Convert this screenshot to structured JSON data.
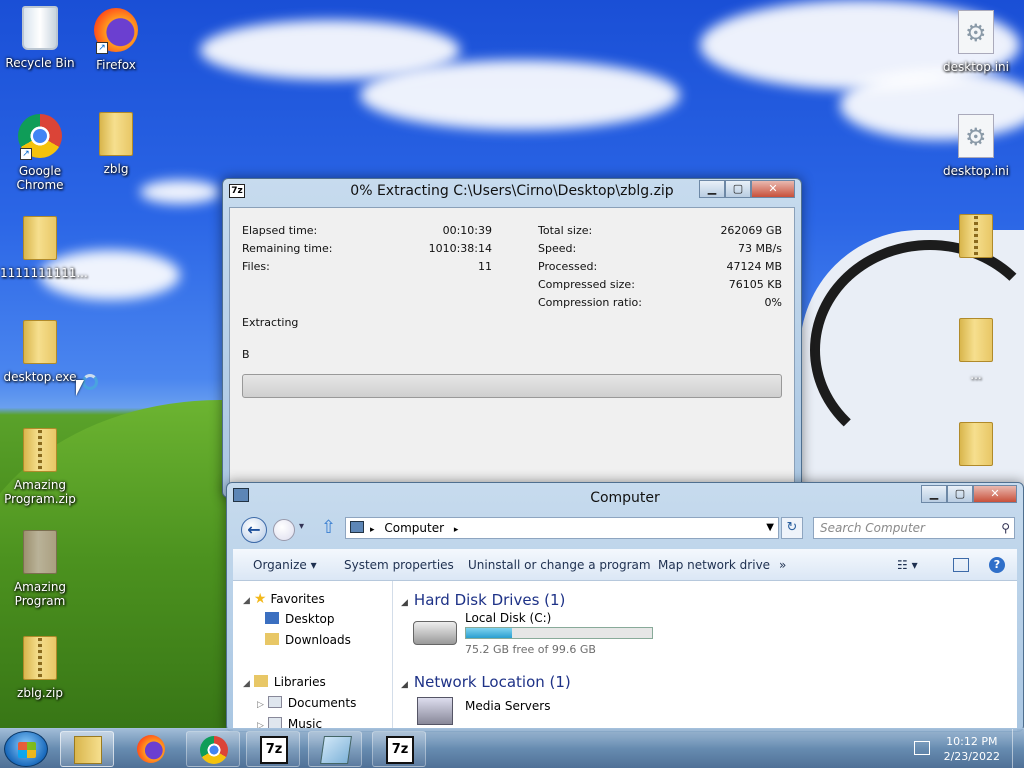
{
  "desktop": {
    "icons": {
      "recycle_bin": "Recycle Bin",
      "firefox": "Firefox",
      "google_chrome": "Google Chrome",
      "zblg_folder": "zblg",
      "folder_1111": "1111111111...",
      "desktop_exe": "desktop.exe",
      "amazing_program_zip": "Amazing Program.zip",
      "amazing_program": "Amazing Program",
      "zblg_zip": "zblg.zip",
      "desktop_ini_1": "desktop.ini",
      "desktop_ini_2": "desktop.ini",
      "folder_dots": "..."
    }
  },
  "zip_window": {
    "app_icon": "7z",
    "title": "0% Extracting C:\\Users\\Cirno\\Desktop\\zblg.zip",
    "elapsed_label": "Elapsed time:",
    "elapsed_value": "00:10:39",
    "remaining_label": "Remaining time:",
    "remaining_value": "1010:38:14",
    "files_label": "Files:",
    "files_value": "11",
    "total_size_label": "Total size:",
    "total_size_value": "262069 GB",
    "speed_label": "Speed:",
    "speed_value": "73 MB/s",
    "processed_label": "Processed:",
    "processed_value": "47124 MB",
    "compressed_label": "Compressed size:",
    "compressed_value": "76105 KB",
    "ratio_label": "Compression ratio:",
    "ratio_value": "0%",
    "status": "Extracting",
    "current_file": "B",
    "progress_percent": 0
  },
  "explorer": {
    "title": "Computer",
    "address_crumb": "Computer",
    "search_placeholder": "Search Computer",
    "toolbar": {
      "organize": "Organize",
      "system_properties": "System properties",
      "uninstall": "Uninstall or change a program",
      "map_network": "Map network drive",
      "more": "»"
    },
    "nav": {
      "favorites": "Favorites",
      "desktop": "Desktop",
      "downloads": "Downloads",
      "libraries": "Libraries",
      "documents": "Documents",
      "music": "Music"
    },
    "groups": {
      "hard_disk": "Hard Disk Drives (1)",
      "network": "Network Location (1)"
    },
    "local_disk": {
      "name": "Local Disk (C:)",
      "free": "75.2 GB free of 99.6 GB",
      "used_fraction": 0.245
    },
    "media_servers": "Media Servers"
  },
  "taskbar": {
    "time": "10:12 PM",
    "date": "2/23/2022",
    "zip_label_1": "7z",
    "zip_label_2": "7z"
  }
}
